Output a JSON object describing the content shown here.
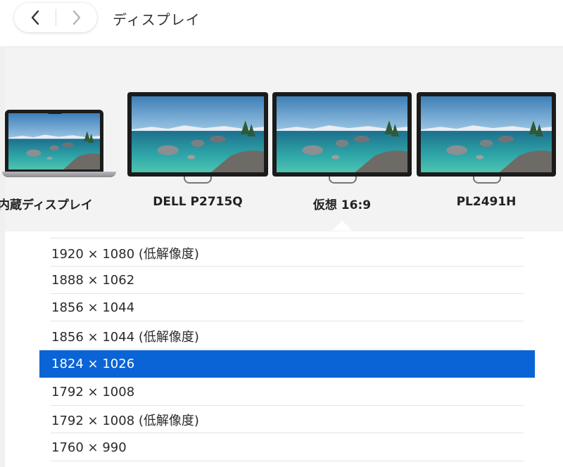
{
  "header": {
    "title": "ディスプレイ",
    "back_icon": "chevron-left-icon",
    "forward_icon": "chevron-right-icon"
  },
  "displays": [
    {
      "label": "内蔵ディスプレイ",
      "kind": "laptop"
    },
    {
      "label": "DELL P2715Q",
      "kind": "monitor"
    },
    {
      "label": "仮想 16:9",
      "kind": "monitor",
      "selected": true
    },
    {
      "label": "PL2491H",
      "kind": "monitor"
    }
  ],
  "resolutions": [
    {
      "label": "1920 × 1080 (低解像度)",
      "selected": false
    },
    {
      "label": "1888 × 1062",
      "selected": false
    },
    {
      "label": "1856 × 1044",
      "selected": false
    },
    {
      "label": "1856 × 1044 (低解像度)",
      "selected": false
    },
    {
      "label": "1824 × 1026",
      "selected": true
    },
    {
      "label": "1792 × 1008",
      "selected": false
    },
    {
      "label": "1792 × 1008 (低解像度)",
      "selected": false
    },
    {
      "label": "1760 × 990",
      "selected": false
    }
  ],
  "colors": {
    "accent": "#0a64d6",
    "panel": "#f3f3f3"
  }
}
